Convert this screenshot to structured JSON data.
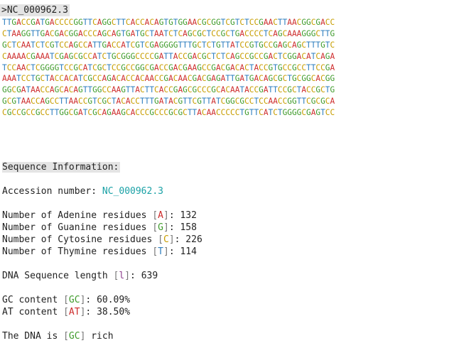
{
  "fasta_header": ">NC_000962.3",
  "sequence_lines": [
    "TTGACCGATGACCCCGGTTCAGGCTTCACCACAGTGTGGAACGCGGTCGTCTCCGAACTTAACGGCGACC",
    "CTAAGGTTGACGACGGACCCAGCAGTGATGCTAATCTCAGCGCTCCGCTGACCCCTCAGCAAAGGGCTTG",
    "GCTCAATCTCGTCCAGCCATTGACCATCGTCGAGGGGTTTGCTCTGTTATCCGTGCCGAGCAGCTTTGTC",
    "CAAAACGAAATCGAGCGCCATCTGCGGGCCCCGATTACCGACGCTCTCAGCCGCCGACTCGGACATCAGA",
    "TCCAACTCGGGGTCCGCATCGCTCCGCCGGCGACCGACGAAGCCGACGACACTACCGTGCCGCCTTCCGA",
    "AAATCCTGCTACCACATCGCCAGACACCACAACCGACAACGACGAGATTGATGACAGCGCTGCGGCACGG",
    "GGCGATAACCAGCACAGTTGGCCAAGTTACTTCACCGAGCGCCCGCACAATACCGATTCCGCTACCGCTG",
    "GCGTAACCAGCCTTAACCGTCGCTACACCTTTGATACGTTCGTTATCGGCGCCTCCAACCGGTTCGCGCA",
    "CGCCGCCGCCTTGGCGATCGCAGAAGCACCCGCCCGCGCTTACAACCCCCTGTTCATCTGGGGCGAGTCC"
  ],
  "base_colors": {
    "A": "#cd2b2b",
    "C": "#c79d00",
    "G": "#3f9b2b",
    "T": "#2f7fbf"
  },
  "info": {
    "section_title": "Sequence Information:",
    "accession_label": "Accession number: ",
    "accession_value": "NC_000962.3",
    "adenine_label": "Number of Adenine residues ",
    "adenine_code": "A",
    "adenine_count": "132",
    "guanine_label": "Number of Guanine residues ",
    "guanine_code": "G",
    "guanine_count": "158",
    "cytosine_label": "Number of Cytosine residues ",
    "cytosine_code": "C",
    "cytosine_count": "226",
    "thymine_label": "Number of Thymine residues ",
    "thymine_code": "T",
    "thymine_count": "114",
    "length_label": "DNA Sequence length ",
    "length_code": "l",
    "length_value": "639",
    "gc_label": "GC content ",
    "gc_code": "GC",
    "gc_value": "60.09%",
    "at_label": "AT content ",
    "at_code": "AT",
    "at_value": "38.50%",
    "rich_prefix": "The DNA is ",
    "rich_code": "GC",
    "rich_suffix": " rich"
  },
  "code_colors": {
    "adenine": "#cd2b2b",
    "guanine": "#3f9b2b",
    "cytosine": "#c79d00",
    "thymine": "#2f7fbf",
    "length": "#8e3f8e",
    "gc": "#3f9b2b",
    "at": "#cd2b2b",
    "rich": "#3f9b2b"
  }
}
